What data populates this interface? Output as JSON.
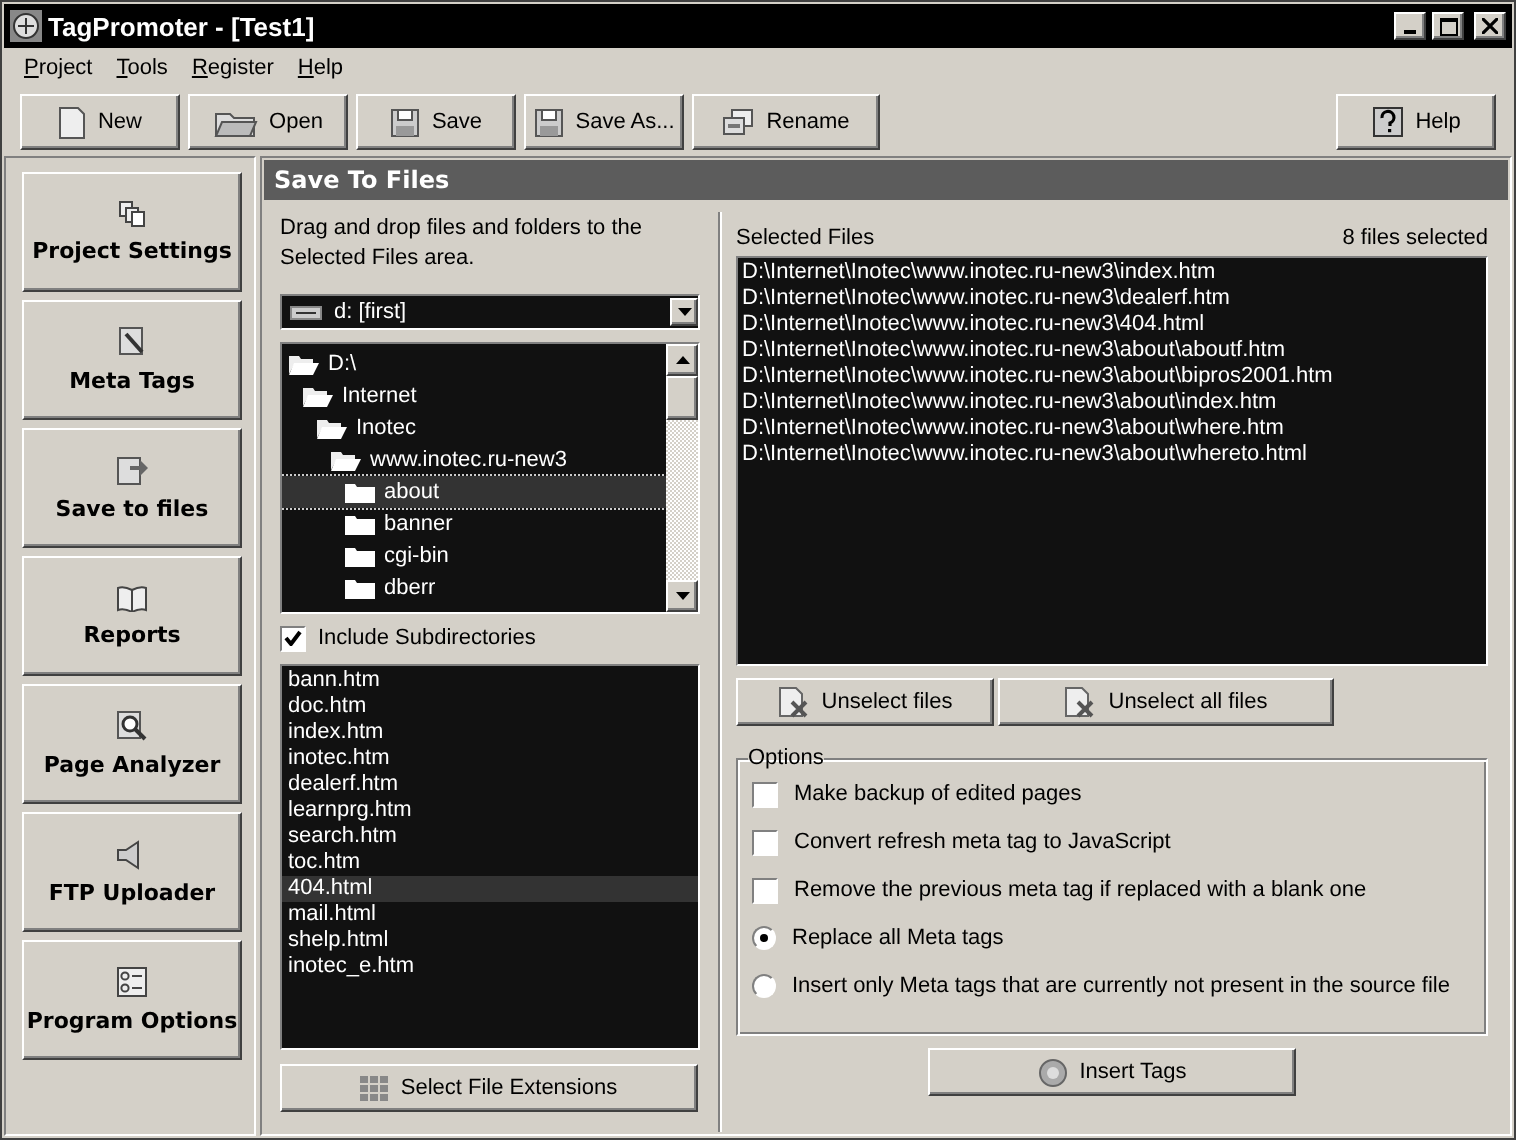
{
  "window": {
    "title": "TagPromoter - [Test1]"
  },
  "menu": [
    {
      "label": "Project"
    },
    {
      "label": "Tools"
    },
    {
      "label": "Register"
    },
    {
      "label": "Help"
    }
  ],
  "toolbar": [
    {
      "label": "New",
      "kind": "new"
    },
    {
      "label": "Open",
      "kind": "open"
    },
    {
      "label": "Save",
      "kind": "save"
    },
    {
      "label": "Save As...",
      "kind": "save"
    },
    {
      "label": "Rename",
      "kind": "rename"
    },
    {
      "label": "Help",
      "kind": "help"
    }
  ],
  "sidebar": {
    "items": [
      {
        "label": "Project Settings",
        "kind": "pages"
      },
      {
        "label": "Meta Tags",
        "kind": "tag"
      },
      {
        "label": "Save to files",
        "kind": "savefile"
      },
      {
        "label": "Reports",
        "kind": "book"
      },
      {
        "label": "Page Analyzer",
        "kind": "magnifier"
      },
      {
        "label": "FTP Uploader",
        "kind": "speaker"
      },
      {
        "label": "Program Options",
        "kind": "options"
      }
    ]
  },
  "panel": {
    "title": "Save To Files",
    "instructions": "Drag and drop files and folders to the Selected Files area.",
    "drive": "d: [first]",
    "folders": [
      {
        "label": "D:\\",
        "selected": false,
        "children": [
          {
            "label": "Internet",
            "selected": false,
            "children": [
              {
                "label": "Inotec",
                "selected": false,
                "children": [
                  {
                    "label": "www.inotec.ru-new3",
                    "selected": false,
                    "children": [
                      {
                        "label": "about",
                        "selected": true
                      },
                      {
                        "label": "banner",
                        "selected": false
                      },
                      {
                        "label": "cgi-bin",
                        "selected": false
                      },
                      {
                        "label": "dberr",
                        "selected": false
                      }
                    ]
                  }
                ]
              }
            ]
          }
        ]
      }
    ],
    "include_subdirectories": {
      "label": "Include Subdirectories",
      "checked": true
    },
    "files": [
      {
        "name": "bann.htm",
        "selected": false
      },
      {
        "name": "doc.htm",
        "selected": false
      },
      {
        "name": "index.htm",
        "selected": false
      },
      {
        "name": "inotec.htm",
        "selected": false
      },
      {
        "name": "dealerf.htm",
        "selected": false
      },
      {
        "name": "learnprg.htm",
        "selected": false
      },
      {
        "name": "search.htm",
        "selected": false
      },
      {
        "name": "toc.htm",
        "selected": false
      },
      {
        "name": "404.html",
        "selected": true
      },
      {
        "name": "mail.html",
        "selected": false
      },
      {
        "name": "shelp.html",
        "selected": false
      },
      {
        "name": "inotec_e.htm",
        "selected": false
      }
    ],
    "select_extensions_button": "Select File Extensions",
    "selected_files": {
      "label": "Selected Files",
      "count": "8 files selected",
      "items": [
        "D:\\Internet\\Inotec\\www.inotec.ru-new3\\index.htm",
        "D:\\Internet\\Inotec\\www.inotec.ru-new3\\dealerf.htm",
        "D:\\Internet\\Inotec\\www.inotec.ru-new3\\404.html",
        "D:\\Internet\\Inotec\\www.inotec.ru-new3\\about\\aboutf.htm",
        "D:\\Internet\\Inotec\\www.inotec.ru-new3\\about\\bipros2001.htm",
        "D:\\Internet\\Inotec\\www.inotec.ru-new3\\about\\index.htm",
        "D:\\Internet\\Inotec\\www.inotec.ru-new3\\about\\where.htm",
        "D:\\Internet\\Inotec\\www.inotec.ru-new3\\about\\whereto.html"
      ]
    },
    "unselect_buttons": [
      "Unselect files",
      "Unselect all files"
    ],
    "options": {
      "title": "Options",
      "items": [
        {
          "kind": "checkbox",
          "label": "Make backup of edited pages",
          "checked": false
        },
        {
          "kind": "checkbox",
          "label": "Convert refresh meta tag to JavaScript",
          "checked": false
        },
        {
          "kind": "checkbox",
          "label": "Remove the previous meta tag if replaced with a blank one",
          "checked": false
        },
        {
          "kind": "radio",
          "label": "Replace all Meta tags",
          "checked": true
        },
        {
          "kind": "radio",
          "label": "Insert only Meta tags that are currently not present in the source file",
          "checked": false
        }
      ]
    },
    "insert_button": "Insert Tags"
  }
}
